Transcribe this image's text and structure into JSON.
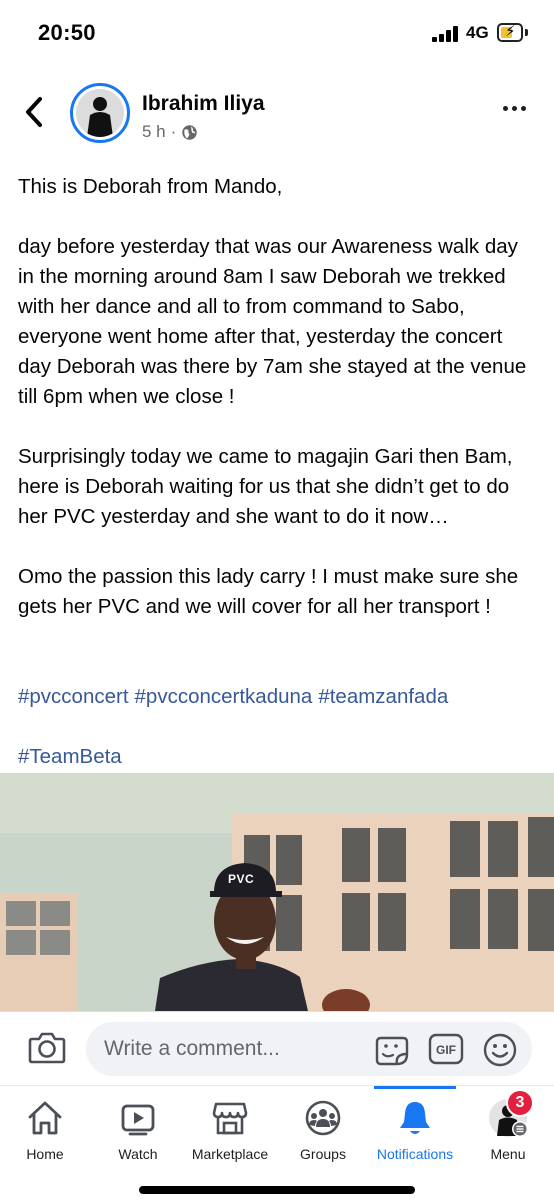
{
  "status_bar": {
    "time": "20:50",
    "network": "4G"
  },
  "post": {
    "author": "Ibrahim Iliya",
    "time_ago": "5 h",
    "separator": "·",
    "privacy_icon": "globe-icon",
    "paragraphs": [
      "This is Deborah from Mando,",
      "day before yesterday that was our Awareness walk day in the morning around 8am I saw Deborah we trekked with her dance and all to from command to Sabo, everyone went home after that, yesterday the concert day Deborah was there by 7am she stayed at the venue till 6pm when we close !",
      "Surprisingly today we came to magajin Gari then Bam, here is Deborah waiting for us that she didn’t get to do her PVC yesterday and she want to do it now…",
      "Omo the passion this lady carry ! I must make sure she gets her PVC and we will cover for all her transport !"
    ],
    "hashtags": [
      "#pvcconcert",
      "#pvcconcertkaduna",
      "#teamzanfada",
      "#TeamBeta"
    ],
    "photo": {
      "cap_text": "PVC"
    }
  },
  "comment_bar": {
    "placeholder": "Write a comment..."
  },
  "tabs": [
    {
      "label": "Home",
      "icon": "home-icon"
    },
    {
      "label": "Watch",
      "icon": "watch-icon"
    },
    {
      "label": "Marketplace",
      "icon": "marketplace-icon"
    },
    {
      "label": "Groups",
      "icon": "groups-icon"
    },
    {
      "label": "Notifications",
      "icon": "bell-icon",
      "active": true
    },
    {
      "label": "Menu",
      "icon": "menu-avatar-icon"
    }
  ],
  "menu_badge": "3",
  "colors": {
    "accent": "#1877f2",
    "hashtag": "#385898",
    "badge": "#e41e3f",
    "battery": "#f2c230"
  }
}
